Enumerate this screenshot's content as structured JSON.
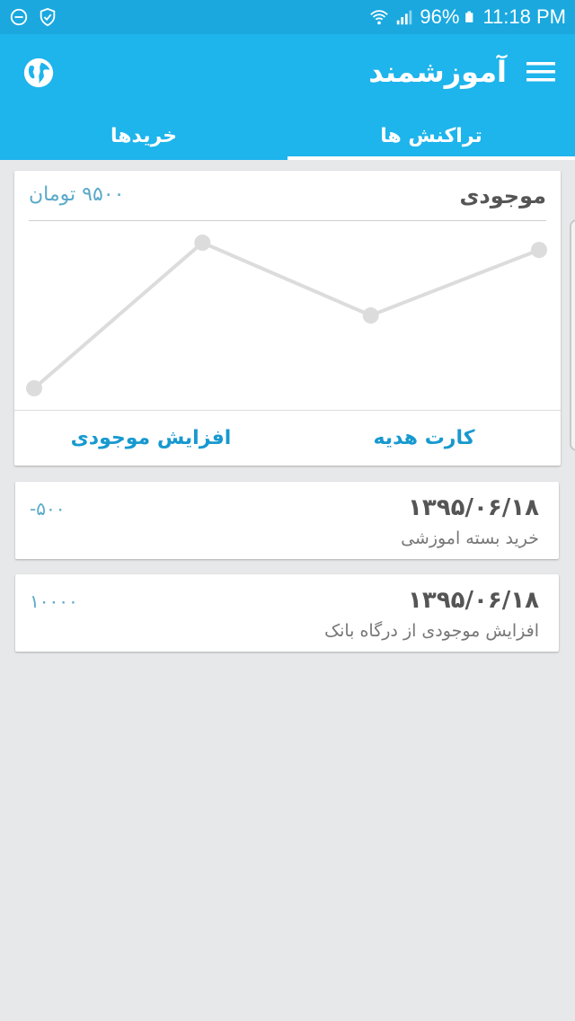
{
  "status_bar": {
    "battery": "96%",
    "time": "11:18 PM",
    "icons": [
      "do-not-disturb-icon",
      "shield-icon",
      "wifi-icon",
      "signal-icon",
      "battery-icon"
    ]
  },
  "app_bar": {
    "title": "آموزشمند",
    "left_icon": "globe-icon",
    "right_icon": "menu-icon",
    "color": "#1eb4ec"
  },
  "tabs": [
    {
      "label": "تراکنش ها",
      "active": true
    },
    {
      "label": "خریدها",
      "active": false
    }
  ],
  "balance_card": {
    "label": "موجودی",
    "amount": "۹۵۰۰ تومان",
    "actions": {
      "gift_card": "کارت هدیه",
      "add_balance": "افزایش موجودی"
    }
  },
  "chart_data": {
    "type": "line",
    "series": [
      {
        "values": [
          0,
          10000,
          5000,
          9500
        ]
      }
    ],
    "grid": false,
    "legend": "none"
  },
  "transactions": [
    {
      "date": "۱۳۹۵/۰۶/۱۸",
      "description": "خرید بسته اموزشی",
      "amount": "-۵۰۰"
    },
    {
      "date": "۱۳۹۵/۰۶/۱۸",
      "description": "افزایش موجودی از درگاه بانک",
      "amount": "۱۰۰۰۰"
    }
  ]
}
